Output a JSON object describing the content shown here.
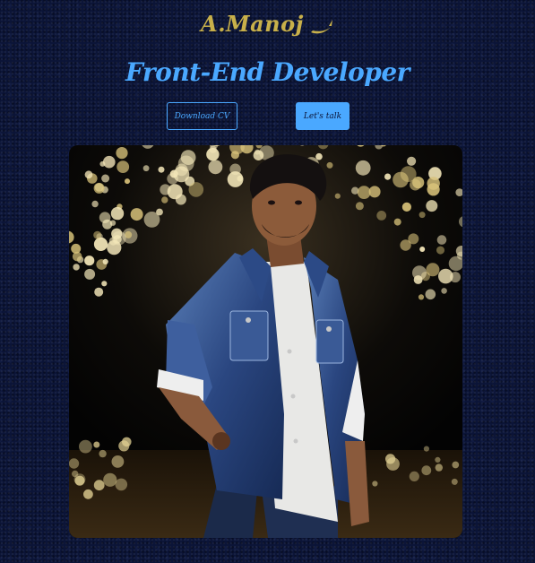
{
  "header": {
    "logo_text": "A.Manoj",
    "logo_icon": "brush-stroke-icon",
    "title": "Front-End Developer"
  },
  "actions": {
    "download_cv_label": "Download CV",
    "lets_talk_label": "Let's talk"
  },
  "colors": {
    "background": "#0b1437",
    "accent": "#4aa8ff",
    "logo_gold": "#c8b04a"
  },
  "portrait": {
    "icon": "profile-photo"
  }
}
